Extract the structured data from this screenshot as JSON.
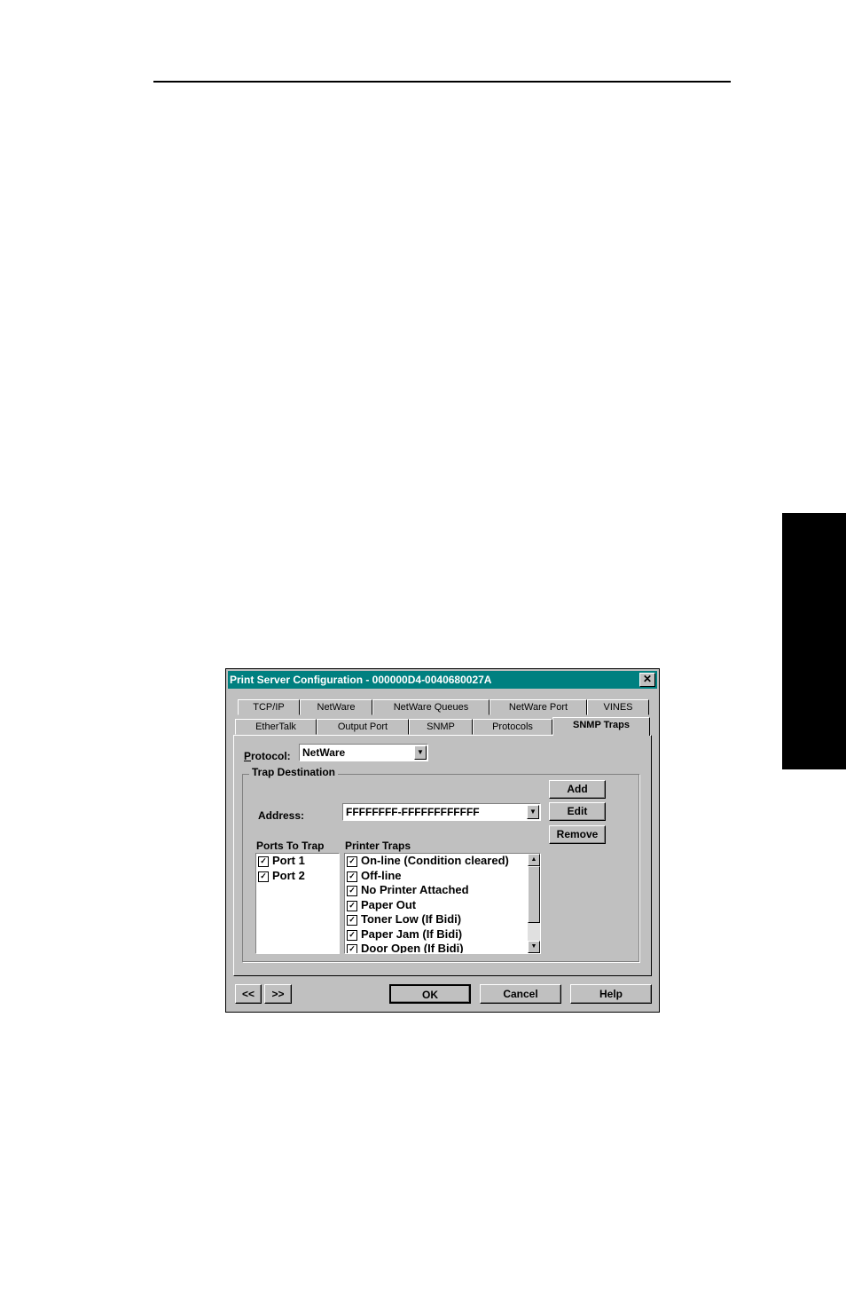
{
  "dialog": {
    "title": "Print Server Configuration - 000000D4-0040680027A",
    "close_glyph": "✕"
  },
  "tabs_row1": [
    "TCP/IP",
    "NetWare",
    "NetWare Queues",
    "NetWare Port",
    "VINES"
  ],
  "tabs_row2": [
    "EtherTalk",
    "Output Port",
    "SNMP",
    "Protocols",
    "SNMP Traps"
  ],
  "active_tab": "SNMP Traps",
  "protocol": {
    "label": "Protocol:",
    "value": "NetWare"
  },
  "trap_destination": {
    "title": "Trap Destination",
    "address_label": "Address:",
    "address_value": "FFFFFFFF-FFFFFFFFFFFF",
    "add_label": "Add",
    "edit_label": "Edit",
    "remove_label": "Remove"
  },
  "ports_to_trap": {
    "header": "Ports To Trap",
    "items": [
      {
        "label": "Port 1",
        "checked": true
      },
      {
        "label": "Port 2",
        "checked": true
      }
    ]
  },
  "printer_traps": {
    "header": "Printer Traps",
    "items": [
      {
        "label": "On-line (Condition cleared)",
        "checked": true
      },
      {
        "label": "Off-line",
        "checked": true
      },
      {
        "label": "No Printer Attached",
        "checked": true
      },
      {
        "label": "Paper Out",
        "checked": true
      },
      {
        "label": "Toner Low (If Bidi)",
        "checked": true
      },
      {
        "label": "Paper Jam (If Bidi)",
        "checked": true
      },
      {
        "label": "Door Open (If Bidi)",
        "checked": true
      }
    ]
  },
  "footer": {
    "prev_label": "<<",
    "next_label": ">>",
    "ok_label": "OK",
    "cancel_label": "Cancel",
    "help_label": "Help"
  },
  "icons": [
    "close-icon",
    "dropdown-arrow-icon",
    "scroll-up-icon",
    "scroll-down-icon",
    "checkbox-icon"
  ]
}
